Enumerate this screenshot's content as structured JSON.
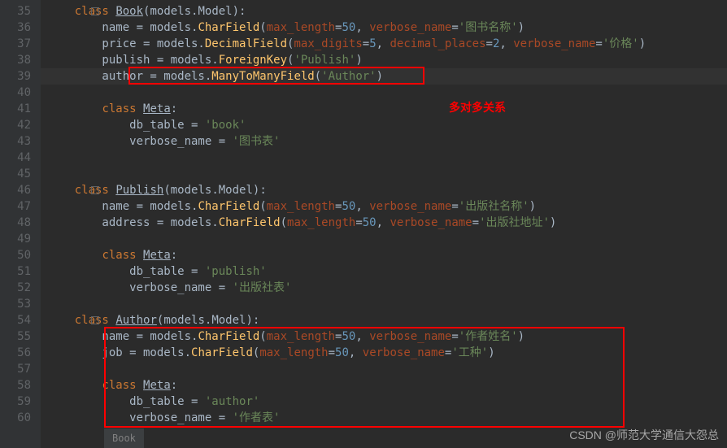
{
  "gutter": {
    "start": 35,
    "end": 60
  },
  "highlightedLine": 39,
  "annotation": "多对多关系",
  "breadcrumb": "Book",
  "watermark": "CSDN @师范大学通信大怨总",
  "code": {
    "l35": {
      "kw": "class",
      "name": "Book",
      "base": "(models.Model):"
    },
    "l36": {
      "pre": "        name = models.",
      "fn": "CharField",
      "p1": "max_length",
      "eq1": "=",
      "v1": "50",
      "c1": ", ",
      "p2": "verbose_name",
      "eq2": "=",
      "s2": "'图书名称'",
      "end": ")"
    },
    "l37": {
      "pre": "        price = models.",
      "fn": "DecimalField",
      "p1": "max_digits",
      "eq1": "=",
      "v1": "5",
      "c1": ", ",
      "p2": "decimal_places",
      "eq2": "=",
      "v2": "2",
      "c2": ", ",
      "p3": "verbose_name",
      "eq3": "=",
      "s3": "'价格'",
      "end": ")"
    },
    "l38": {
      "pre": "        publish = models.",
      "fn": "ForeignKey",
      "s1": "'Publish'",
      "end": ")"
    },
    "l39": {
      "pre": "        author = models.",
      "fn": "ManyToManyField",
      "s1": "'Author'",
      "end": ")"
    },
    "l41": {
      "kw": "class",
      "name": "Meta",
      "end": ":"
    },
    "l42": {
      "pre": "            db_table = ",
      "s1": "'book'"
    },
    "l43": {
      "pre": "            verbose_name = ",
      "s1": "'图书表'"
    },
    "l46": {
      "kw": "class",
      "name": "Publish",
      "base": "(models.Model):"
    },
    "l47": {
      "pre": "        name = models.",
      "fn": "CharField",
      "p1": "max_length",
      "eq1": "=",
      "v1": "50",
      "c1": ", ",
      "p2": "verbose_name",
      "eq2": "=",
      "s2": "'出版社名称'",
      "end": ")"
    },
    "l48": {
      "pre": "        address = models.",
      "fn": "CharField",
      "p1": "max_length",
      "eq1": "=",
      "v1": "50",
      "c1": ", ",
      "p2": "verbose_name",
      "eq2": "=",
      "s2": "'出版社地址'",
      "end": ")"
    },
    "l50": {
      "kw": "class",
      "name": "Meta",
      "end": ":"
    },
    "l51": {
      "pre": "            db_table = ",
      "s1": "'publish'"
    },
    "l52": {
      "pre": "            verbose_name = ",
      "s1": "'出版社表'"
    },
    "l54": {
      "kw": "class",
      "name": "Author",
      "base": "(models.Model):"
    },
    "l55": {
      "pre": "        name = models.",
      "fn": "CharField",
      "p1": "max_length",
      "eq1": "=",
      "v1": "50",
      "c1": ", ",
      "p2": "verbose_name",
      "eq2": "=",
      "s2": "'作者姓名'",
      "end": ")"
    },
    "l56": {
      "pre": "        job = models.",
      "fn": "CharField",
      "p1": "max_length",
      "eq1": "=",
      "v1": "50",
      "c1": ", ",
      "p2": "verbose_name",
      "eq2": "=",
      "s2": "'工种'",
      "end": ")"
    },
    "l58": {
      "kw": "class",
      "name": "Meta",
      "end": ":"
    },
    "l59": {
      "pre": "            db_table = ",
      "s1": "'author'"
    },
    "l60": {
      "pre": "            verbose_name = ",
      "s1": "'作者表'"
    }
  }
}
